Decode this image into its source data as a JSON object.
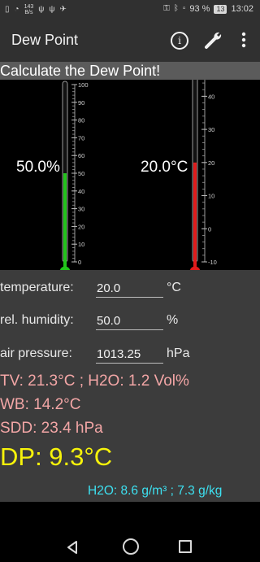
{
  "status_bar": {
    "net_speed_value": "143",
    "net_speed_unit": "B/s",
    "battery_percent": "93 %",
    "battery_level": "13",
    "time": "13:02"
  },
  "app_bar": {
    "title": "Dew Point",
    "info_icon": "info-icon",
    "settings_icon": "wrench-icon",
    "menu_icon": "more-vert-icon"
  },
  "headline": "Calculate the Dew Point!",
  "thermometers": {
    "humidity": {
      "display": "50.0%",
      "value": 50.0,
      "min": 0,
      "max": 100,
      "ticks": [
        "100",
        "90",
        "80",
        "70",
        "60",
        "50",
        "40",
        "30",
        "20",
        "10",
        "0"
      ],
      "color": "#22c41b"
    },
    "temperature": {
      "display": "20.0°C",
      "value": 20.0,
      "min": -10,
      "max": 45,
      "ticks": [
        "40",
        "30",
        "20",
        "10",
        "0",
        "-10"
      ],
      "color": "#e01b1b"
    }
  },
  "form": {
    "temperature": {
      "label": "temperature:",
      "value": "20.0",
      "unit": "°C"
    },
    "humidity": {
      "label": "rel. humidity:",
      "value": "50.0",
      "unit": "%"
    },
    "pressure": {
      "label": "air pressure:",
      "value": "1013.25",
      "unit": "hPa"
    }
  },
  "results": {
    "tv_h2o": "TV: 21.3°C ; H2O: 1.2 Vol%",
    "wb": "WB: 14.2°C",
    "sdd": "SDD: 23.4 hPa",
    "dp": "DP: 9.3°C",
    "h2o_abs": "H2O: 8.6 g/m³ ; 7.3 g/kg"
  },
  "navigation": {
    "back_icon": "back-triangle-icon",
    "home_icon": "home-circle-icon",
    "recent_icon": "recent-square-icon"
  }
}
